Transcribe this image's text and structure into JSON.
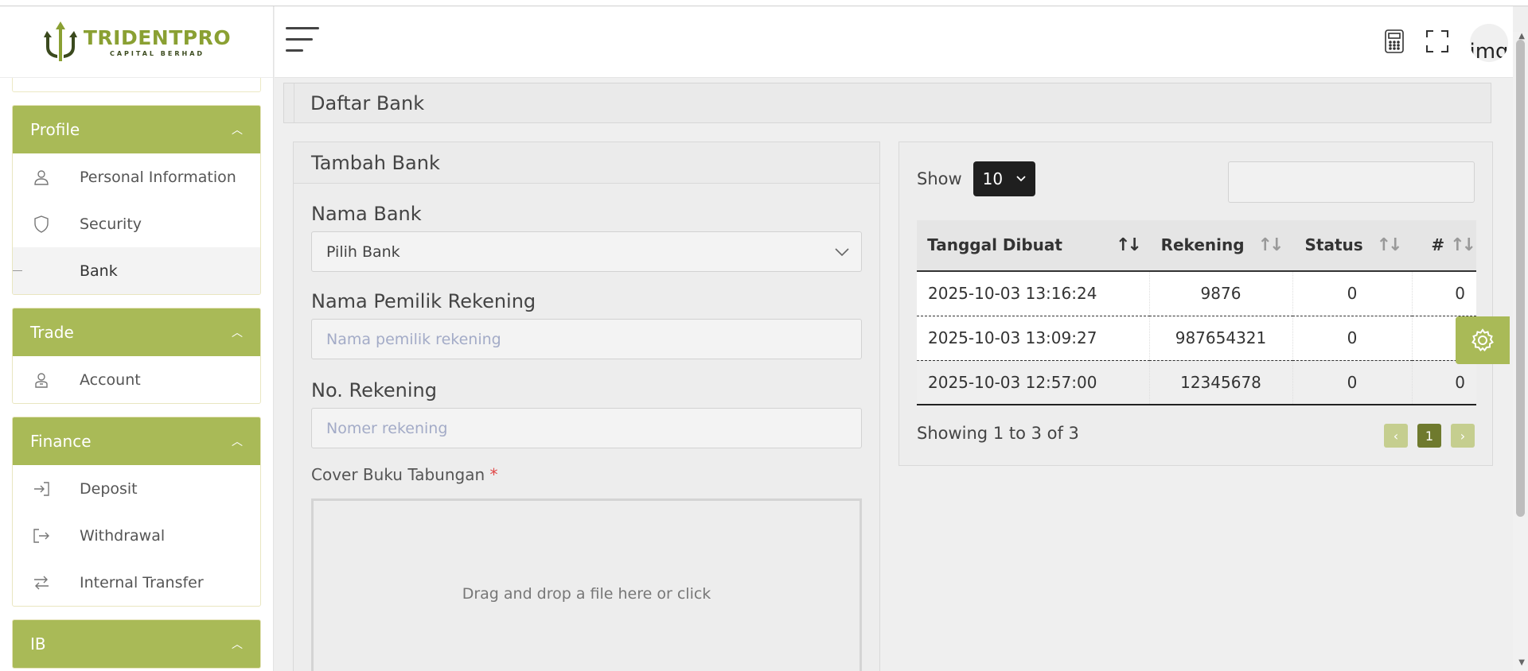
{
  "brand": {
    "name": "TRIDENTPRO",
    "tagline": "CAPITAL BERHAD",
    "accent_color": "#a9ba57"
  },
  "sidebar": {
    "groups": [
      {
        "title": "Profile",
        "items": [
          {
            "label": "Personal Information",
            "icon": "user-icon"
          },
          {
            "label": "Security",
            "icon": "shield-icon"
          },
          {
            "label": "Bank",
            "icon": "none",
            "active": true
          }
        ]
      },
      {
        "title": "Trade",
        "items": [
          {
            "label": "Account",
            "icon": "user-account-icon"
          }
        ]
      },
      {
        "title": "Finance",
        "items": [
          {
            "label": "Deposit",
            "icon": "login-arrow-icon"
          },
          {
            "label": "Withdrawal",
            "icon": "logout-arrow-icon"
          },
          {
            "label": "Internal Transfer",
            "icon": "swap-arrows-icon"
          }
        ]
      },
      {
        "title": "IB",
        "items": []
      }
    ]
  },
  "header": {
    "avatar_alt": "img"
  },
  "page": {
    "title": "Daftar Bank"
  },
  "form": {
    "title": "Tambah Bank",
    "bank_label": "Nama Bank",
    "bank_value": "Pilih Bank",
    "owner_label": "Nama Pemilik Rekening",
    "owner_placeholder": "Nama pemilik rekening",
    "account_label": "No. Rekening",
    "account_placeholder": "Nomer rekening",
    "cover_label": "Cover Buku Tabungan",
    "required_mark": "*",
    "dropzone_text": "Drag and drop a file here or click"
  },
  "table": {
    "show_label": "Show",
    "page_size": "10",
    "columns": [
      "Tanggal Dibuat",
      "Rekening",
      "Status",
      "#"
    ],
    "rows": [
      [
        "2025-10-03 13:16:24",
        "9876",
        "0",
        "0"
      ],
      [
        "2025-10-03 13:09:27",
        "987654321",
        "0",
        "0"
      ],
      [
        "2025-10-03 12:57:00",
        "12345678",
        "0",
        "0"
      ]
    ],
    "info": "Showing 1 to 3 of 3",
    "current_page": "1",
    "prev": "‹",
    "next": "›"
  }
}
